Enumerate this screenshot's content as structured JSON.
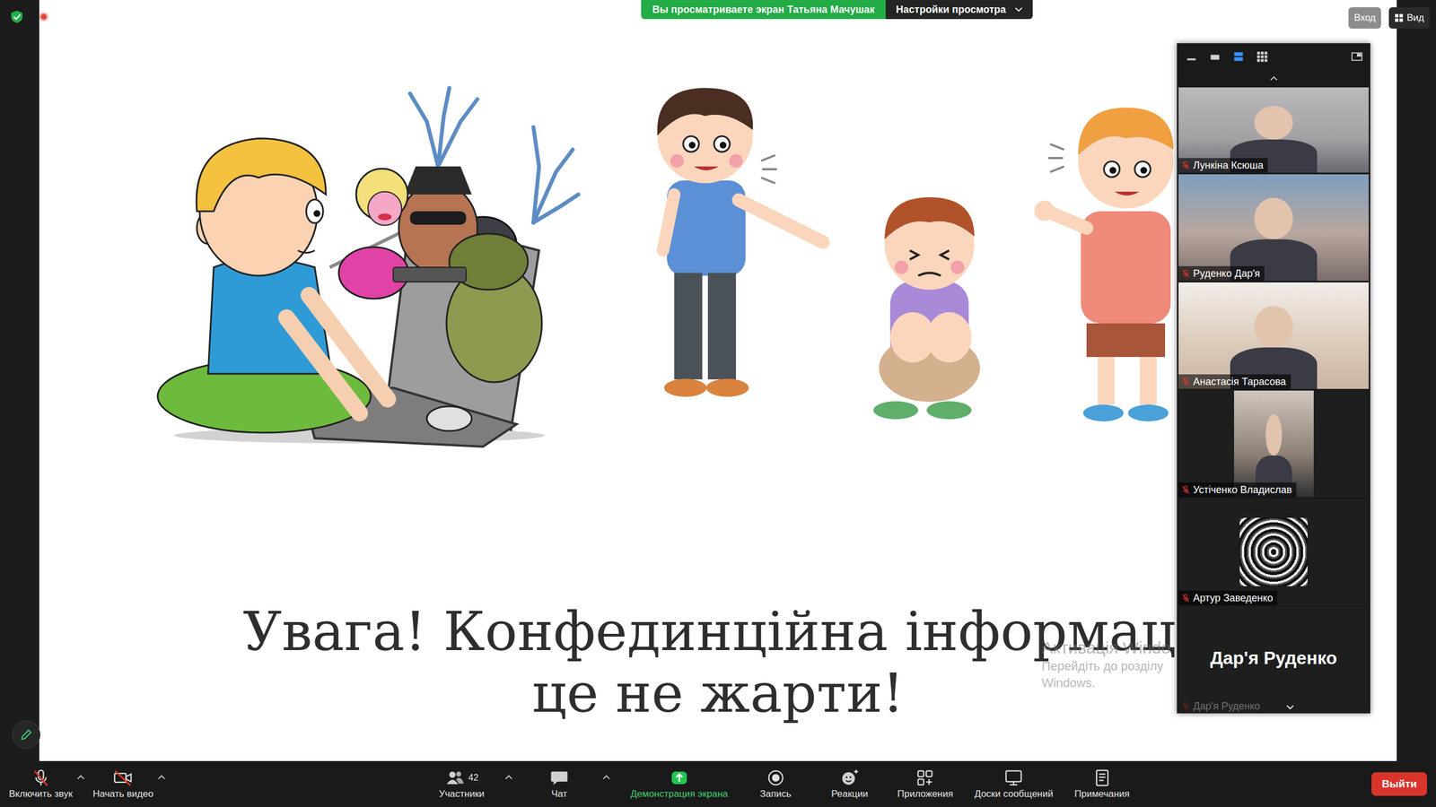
{
  "banner": {
    "viewing": "Вы просматриваете экран Татьяна Мачушак",
    "settings": "Настройки просмотра"
  },
  "top_buttons": {
    "sign_in": "Вход",
    "view": "Вид"
  },
  "slide": {
    "title": [
      "Увага! Конфединційна інформаці",
      "це не жарти!"
    ]
  },
  "watermark": [
    "Активація Windo",
    "Перейдіть до розділу",
    "Windows."
  ],
  "gallery": {
    "view_modes": [
      {
        "kind": "minimize",
        "selected": false
      },
      {
        "kind": "thumbnail",
        "selected": false
      },
      {
        "kind": "speaker",
        "selected": true
      },
      {
        "kind": "gallery",
        "selected": false
      }
    ],
    "participants": [
      {
        "name": "Лункіна Ксюша",
        "muted": true,
        "kind": "video"
      },
      {
        "name": "Руденко Дар'я",
        "muted": true,
        "kind": "video"
      },
      {
        "name": "Анастасія Тарасова",
        "muted": true,
        "kind": "video"
      },
      {
        "name": "Устіченко Владислав",
        "muted": true,
        "kind": "narrow"
      },
      {
        "name": "Артур Заведенко",
        "muted": true,
        "kind": "avatar"
      },
      {
        "name": "Дар'я Руденко",
        "muted": true,
        "kind": "nameonly"
      }
    ]
  },
  "toolbar": {
    "left": [
      {
        "kind": "mic",
        "label": "Включить звук",
        "off": true,
        "has_menu": true
      },
      {
        "kind": "video",
        "label": "Начать видео",
        "off": true,
        "has_menu": true
      }
    ],
    "center": [
      {
        "kind": "participants",
        "label": "Участники",
        "count": "42",
        "has_menu": true,
        "active": false
      },
      {
        "kind": "chat",
        "label": "Чат",
        "has_menu": true,
        "active": false
      },
      {
        "kind": "share",
        "label": "Демонстрация экрана",
        "has_menu": false,
        "active": true
      },
      {
        "kind": "record",
        "label": "Запись",
        "has_menu": false,
        "active": false
      },
      {
        "kind": "reactions",
        "label": "Реакции",
        "has_menu": false,
        "active": false
      },
      {
        "kind": "apps",
        "label": "Приложения",
        "has_menu": false,
        "active": false
      },
      {
        "kind": "whiteboards",
        "label": "Доски сообщений",
        "has_menu": false,
        "active": false
      },
      {
        "kind": "notes",
        "label": "Примечания",
        "has_menu": false,
        "active": false
      }
    ],
    "leave": "Выйти"
  }
}
